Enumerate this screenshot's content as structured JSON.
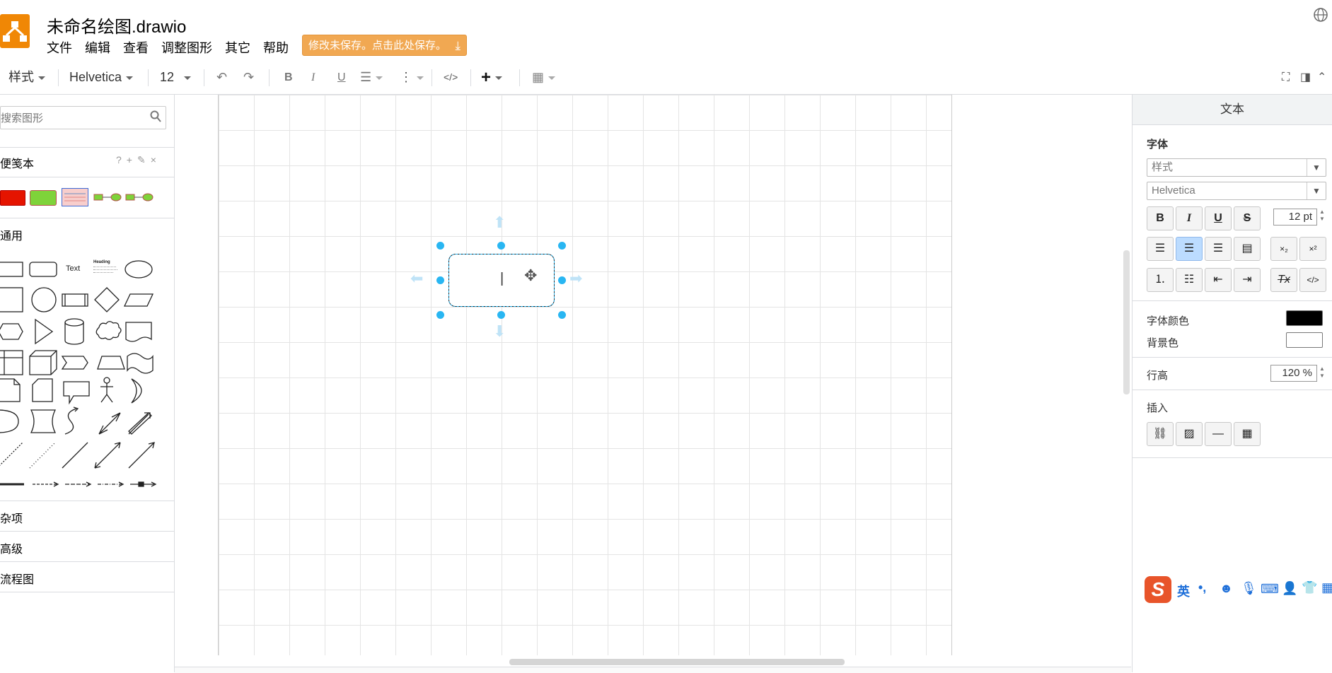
{
  "app": {
    "title": "未命名绘图.drawio",
    "menu": [
      "文件",
      "编辑",
      "查看",
      "调整图形",
      "其它",
      "帮助"
    ],
    "save_banner": "修改未保存。点击此处保存。",
    "brand_color": "#f08705"
  },
  "toolbar": {
    "style_label": "样式",
    "font_family": "Helvetica",
    "font_size": "12",
    "bold": "B",
    "italic": "I",
    "underline": "U",
    "html_label": "</>",
    "insert_label": "+"
  },
  "sidebar": {
    "search_placeholder": "搜索图形",
    "scratchpad_title": "便笺本",
    "scratchpad_actions": [
      "?",
      "+",
      "✎",
      "×"
    ],
    "general_title": "通用",
    "shape_text": "Text",
    "shape_heading": "Heading",
    "misc_title": "杂项",
    "advanced_title": "高级",
    "flowchart_title": "流程图"
  },
  "canvas": {
    "edit_cursor": "|"
  },
  "format_panel": {
    "tab_label": "文本",
    "font_section": "字体",
    "style_select": "样式",
    "font_select": "Helvetica",
    "font_size_value": "12 pt",
    "bold": "B",
    "italic": "I",
    "underline": "U",
    "strike": "S",
    "font_color_label": "字体颜色",
    "bg_color_label": "背景色",
    "font_color": "#000000",
    "bg_color": "#ffffff",
    "line_height_label": "行高",
    "line_height_value": "120 %",
    "insert_section": "插入",
    "subscript": "×₂",
    "superscript": "×²",
    "clear_format": "Tx",
    "html_btn": "</>"
  },
  "ime": {
    "mode": "英",
    "punct": "•,",
    "accent_color": "#e8542a"
  }
}
